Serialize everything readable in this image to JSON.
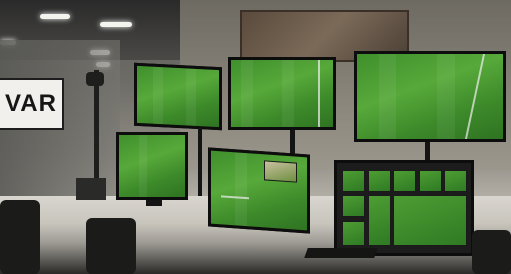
{
  "sign": {
    "text": "VAR"
  },
  "scene": {
    "description_icons": [
      "var-sign",
      "monitor"
    ],
    "colors": {
      "pitch": "#4f9e36",
      "bezel": "#121212",
      "desk": "#d6d3cc"
    }
  }
}
